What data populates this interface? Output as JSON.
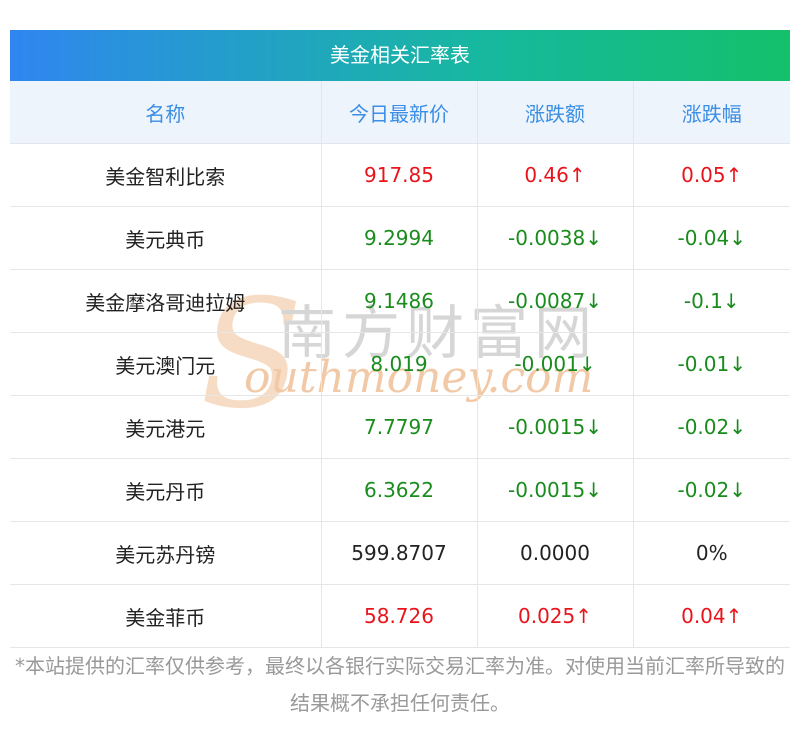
{
  "title": "美金相关汇率表",
  "headers": [
    "名称",
    "今日最新价",
    "涨跌额",
    "涨跌幅"
  ],
  "rows": [
    {
      "name": "美金智利比索",
      "price": "917.85",
      "change": "0.46↑",
      "pct": "0.05↑",
      "trend": "up"
    },
    {
      "name": "美元典币",
      "price": "9.2994",
      "change": "-0.0038↓",
      "pct": "-0.04↓",
      "trend": "down"
    },
    {
      "name": "美金摩洛哥迪拉姆",
      "price": "9.1486",
      "change": "-0.0087↓",
      "pct": "-0.1↓",
      "trend": "down"
    },
    {
      "name": "美元澳门元",
      "price": "8.019",
      "change": "-0.001↓",
      "pct": "-0.01↓",
      "trend": "down"
    },
    {
      "name": "美元港元",
      "price": "7.7797",
      "change": "-0.0015↓",
      "pct": "-0.02↓",
      "trend": "down"
    },
    {
      "name": "美元丹币",
      "price": "6.3622",
      "change": "-0.0015↓",
      "pct": "-0.02↓",
      "trend": "down"
    },
    {
      "name": "美元苏丹镑",
      "price": "599.8707",
      "change": "0.0000",
      "pct": "0%",
      "trend": "flat"
    },
    {
      "name": "美金菲币",
      "price": "58.726",
      "change": "0.025↑",
      "pct": "0.04↑",
      "trend": "up"
    }
  ],
  "watermark": {
    "cn": "南方财富网",
    "en": "outhmoney.com",
    "s": "S"
  },
  "note": "*本站提供的汇率仅供参考，最终以各银行实际交易汇率为准。对使用当前汇率所导致的结果概不承担任何责任。",
  "colors": {
    "up": "#e8141c",
    "down": "#1a8c1e",
    "header_text": "#3a8ee6",
    "gradient_start": "#2f86f0",
    "gradient_end": "#14c06a"
  }
}
